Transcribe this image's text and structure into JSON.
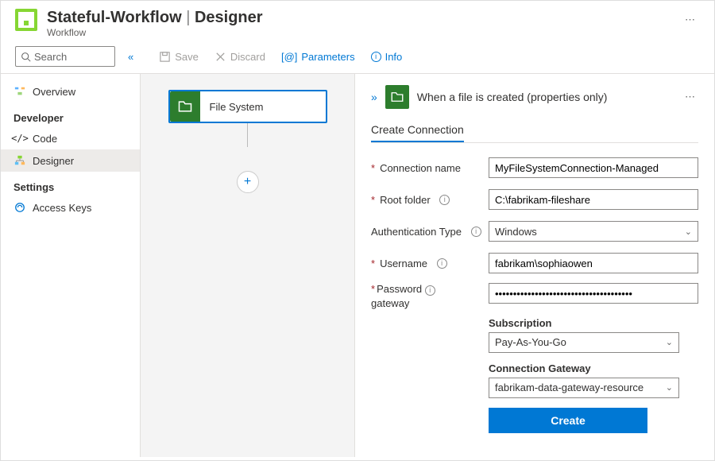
{
  "header": {
    "title": "Stateful-Workflow",
    "section": "Designer",
    "subtitle": "Workflow"
  },
  "toolbar": {
    "search_placeholder": "Search",
    "save": "Save",
    "discard": "Discard",
    "parameters": "Parameters",
    "info": "Info"
  },
  "sidebar": {
    "overview": "Overview",
    "group_dev": "Developer",
    "code": "Code",
    "designer": "Designer",
    "group_settings": "Settings",
    "access_keys": "Access Keys"
  },
  "canvas": {
    "card_title": "File System"
  },
  "panel": {
    "title": "When a file is created (properties only)",
    "tab": "Create Connection",
    "labels": {
      "connection_name": "Connection name",
      "root_folder": "Root folder",
      "auth_type": "Authentication Type",
      "username": "Username",
      "password": "Password",
      "gateway": "gateway",
      "subscription": "Subscription",
      "connection_gateway": "Connection Gateway"
    },
    "values": {
      "connection_name": "MyFileSystemConnection-Managed",
      "root_folder": "C:\\fabrikam-fileshare",
      "auth_type": "Windows",
      "username": "fabrikam\\sophiaowen",
      "password": "••••••••••••••••••••••••••••••••••••••",
      "subscription": "Pay-As-You-Go",
      "connection_gateway": "fabrikam-data-gateway-resource"
    },
    "create_button": "Create"
  }
}
